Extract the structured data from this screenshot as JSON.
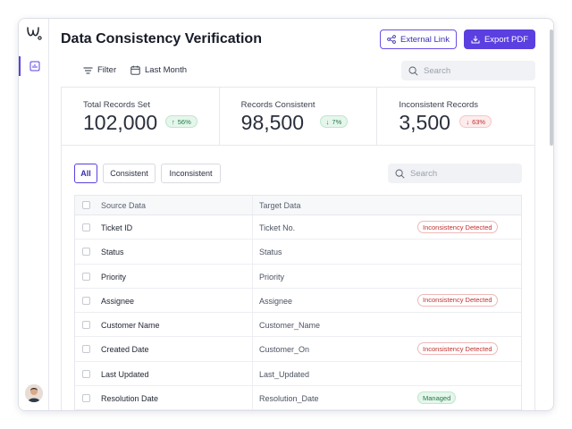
{
  "header": {
    "title": "Data Consistency Verification",
    "external_link_label": "External Link",
    "export_pdf_label": "Export PDF"
  },
  "toolbar": {
    "filter_label": "Filter",
    "date_label": "Last Month",
    "search_placeholder": "Search"
  },
  "stats": [
    {
      "label": "Total Records Set",
      "value": "102,000",
      "change": "56%",
      "direction": "up"
    },
    {
      "label": "Records Consistent",
      "value": "98,500",
      "change": "7%",
      "direction": "down-green"
    },
    {
      "label": "Inconsistent Records",
      "value": "3,500",
      "change": "63%",
      "direction": "down"
    }
  ],
  "filters": {
    "tabs": [
      "All",
      "Consistent",
      "Inconsistent"
    ],
    "active": "All",
    "search_placeholder": "Search"
  },
  "table": {
    "columns": [
      "Source Data",
      "Target Data"
    ],
    "rows": [
      {
        "source": "Ticket ID",
        "target": "Ticket No.",
        "status": "Inconsistency Detected",
        "status_type": "bad"
      },
      {
        "source": "Status",
        "target": "Status",
        "status": "",
        "status_type": ""
      },
      {
        "source": "Priority",
        "target": "Priority",
        "status": "",
        "status_type": ""
      },
      {
        "source": "Assignee",
        "target": "Assignee",
        "status": "Inconsistency Detected",
        "status_type": "bad"
      },
      {
        "source": "Customer Name",
        "target": "Customer_Name",
        "status": "",
        "status_type": ""
      },
      {
        "source": "Created Date",
        "target": "Customer_On",
        "status": "Inconsistency Detected",
        "status_type": "bad"
      },
      {
        "source": "Last Updated",
        "target": "Last_Updated",
        "status": "",
        "status_type": ""
      },
      {
        "source": "Resolution Date",
        "target": "Resolution_Date",
        "status": "Managed",
        "status_type": "ok"
      }
    ]
  },
  "colors": {
    "accent": "#5b3fe0",
    "error": "#c0312f",
    "success": "#1f7a45"
  },
  "icons": {
    "logo": "brand-logo-icon",
    "nav": "chart-icon",
    "external": "share-icon",
    "export": "download-icon",
    "filter": "filter-icon",
    "date": "calendar-icon",
    "search": "search-icon"
  }
}
